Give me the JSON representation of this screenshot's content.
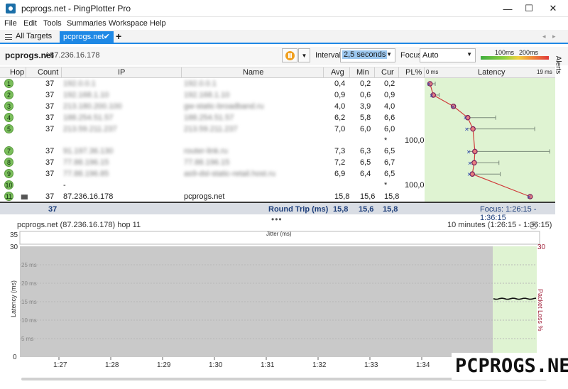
{
  "window": {
    "title": "pcprogs.net - PingPlotter Pro",
    "minimize": "—",
    "maximize": "☐",
    "close": "✕"
  },
  "menu": [
    "File",
    "Edit",
    "Tools",
    "Summaries",
    "Workspace",
    "Help"
  ],
  "tabs": {
    "all_targets": "All Targets",
    "active": "pcprogs.net",
    "add": "+"
  },
  "toolbar": {
    "target": "pcprogs.net",
    "ip": "/ 87.236.16.178",
    "interval_label": "Interval",
    "interval_value": "2,5 seconds",
    "focus_label": "Focus",
    "focus_value": "Auto",
    "scale_a": "100ms",
    "scale_b": "200ms",
    "alerts": "Alerts"
  },
  "columns": {
    "hop": "Hop",
    "count": "Count",
    "ip": "IP",
    "name": "Name",
    "avg": "Avg",
    "min": "Min",
    "cur": "Cur",
    "pl": "PL%",
    "latency": "Latency",
    "lat_min": "0 ms",
    "lat_max": "19 ms"
  },
  "rows": [
    {
      "hop": "1",
      "count": "37",
      "ip": "192.0.0.1",
      "name": "192.0.0.1",
      "avg": "0,4",
      "min": "0,2",
      "cur": "0,2",
      "pl": "",
      "blur": true,
      "lat": 0.4,
      "latmin": 0.2,
      "latmax": 1.2
    },
    {
      "hop": "2",
      "count": "37",
      "ip": "192.168.1.10",
      "name": "192.168.1.10",
      "avg": "0,9",
      "min": "0,6",
      "cur": "0,9",
      "pl": "",
      "blur": true,
      "lat": 0.9,
      "latmin": 0.6,
      "latmax": 1.8
    },
    {
      "hop": "3",
      "count": "37",
      "ip": "213.180.200.100",
      "name": "gw-static-broadband.ru",
      "avg": "4,0",
      "min": "3,9",
      "cur": "4,0",
      "pl": "",
      "blur": true,
      "lat": 4.0,
      "latmin": 3.9,
      "latmax": 4.2
    },
    {
      "hop": "4",
      "count": "37",
      "ip": "188.254.51.57",
      "name": "188.254.51.57",
      "avg": "6,2",
      "min": "5,8",
      "cur": "6,6",
      "pl": "",
      "blur": true,
      "lat": 6.2,
      "latmin": 5.8,
      "latmax": 10.5
    },
    {
      "hop": "5",
      "count": "37",
      "ip": "213.59.211.237",
      "name": "213.59.211.237",
      "avg": "7,0",
      "min": "6,0",
      "cur": "6,0",
      "pl": "",
      "blur": true,
      "lat": 7.0,
      "latmin": 6.0,
      "latmax": 16.5
    },
    {
      "hop": "6",
      "count": "",
      "ip": "",
      "name": "",
      "avg": "",
      "min": "",
      "cur": "*",
      "pl": "100,0",
      "blur": false,
      "lat": null
    },
    {
      "hop": "7",
      "count": "37",
      "ip": "91.197.36.130",
      "name": "router-link.ru",
      "avg": "7,3",
      "min": "6,3",
      "cur": "6,5",
      "pl": "",
      "blur": true,
      "lat": 7.3,
      "latmin": 6.3,
      "latmax": 18.8
    },
    {
      "hop": "8",
      "count": "37",
      "ip": "77.88.196.15",
      "name": "77.88.196.15",
      "avg": "7,2",
      "min": "6,5",
      "cur": "6,7",
      "pl": "",
      "blur": true,
      "lat": 7.2,
      "latmin": 6.5,
      "latmax": 11.0
    },
    {
      "hop": "9",
      "count": "37",
      "ip": "77.88.196.85",
      "name": "as9-dsl-static-retail.host.ru",
      "avg": "6,9",
      "min": "6,4",
      "cur": "6,5",
      "pl": "",
      "blur": true,
      "lat": 6.9,
      "latmin": 6.4,
      "latmax": 11.2
    },
    {
      "hop": "10",
      "count": "",
      "ip": "-",
      "name": "",
      "avg": "",
      "min": "",
      "cur": "*",
      "pl": "100,0",
      "blur": false,
      "lat": null
    },
    {
      "hop": "11",
      "count": "37",
      "ip": "87.236.16.178",
      "name": "pcprogs.net",
      "avg": "15,8",
      "min": "15,6",
      "cur": "15,8",
      "pl": "",
      "blur": false,
      "lat": 15.8,
      "latmin": 15.6,
      "latmax": 15.9
    }
  ],
  "summary": {
    "count": "37",
    "label": "Round Trip (ms)",
    "avg": "15,8",
    "min": "15,6",
    "cur": "15,8",
    "focus": "Focus: 1:26:15 - 1:36:15"
  },
  "lower": {
    "title": "pcprogs.net (87.236.16.178) hop 11",
    "range": "10 minutes (1:26:15 - 1:36:15)",
    "jitter_label": "Jitter (ms)",
    "jitter_max": "35",
    "y_max": "30",
    "y_ticks": [
      "25 ms",
      "20 ms",
      "15 ms",
      "10 ms",
      "5 ms"
    ],
    "y_zero": "0",
    "ylabel": "Latency (ms)",
    "pl_label": "Packet Loss %",
    "pl_max": "30",
    "x_ticks": [
      "1:27",
      "1:28",
      "1:29",
      "1:30",
      "1:31",
      "1:32",
      "1:33",
      "1:34"
    ]
  },
  "watermark": "PCPROGS.NET",
  "colors": {
    "accent": "#1e88e5",
    "hop_green": "#7bbf5c",
    "latency_bg": "#dff3d2",
    "line": "#d03a3a"
  }
}
